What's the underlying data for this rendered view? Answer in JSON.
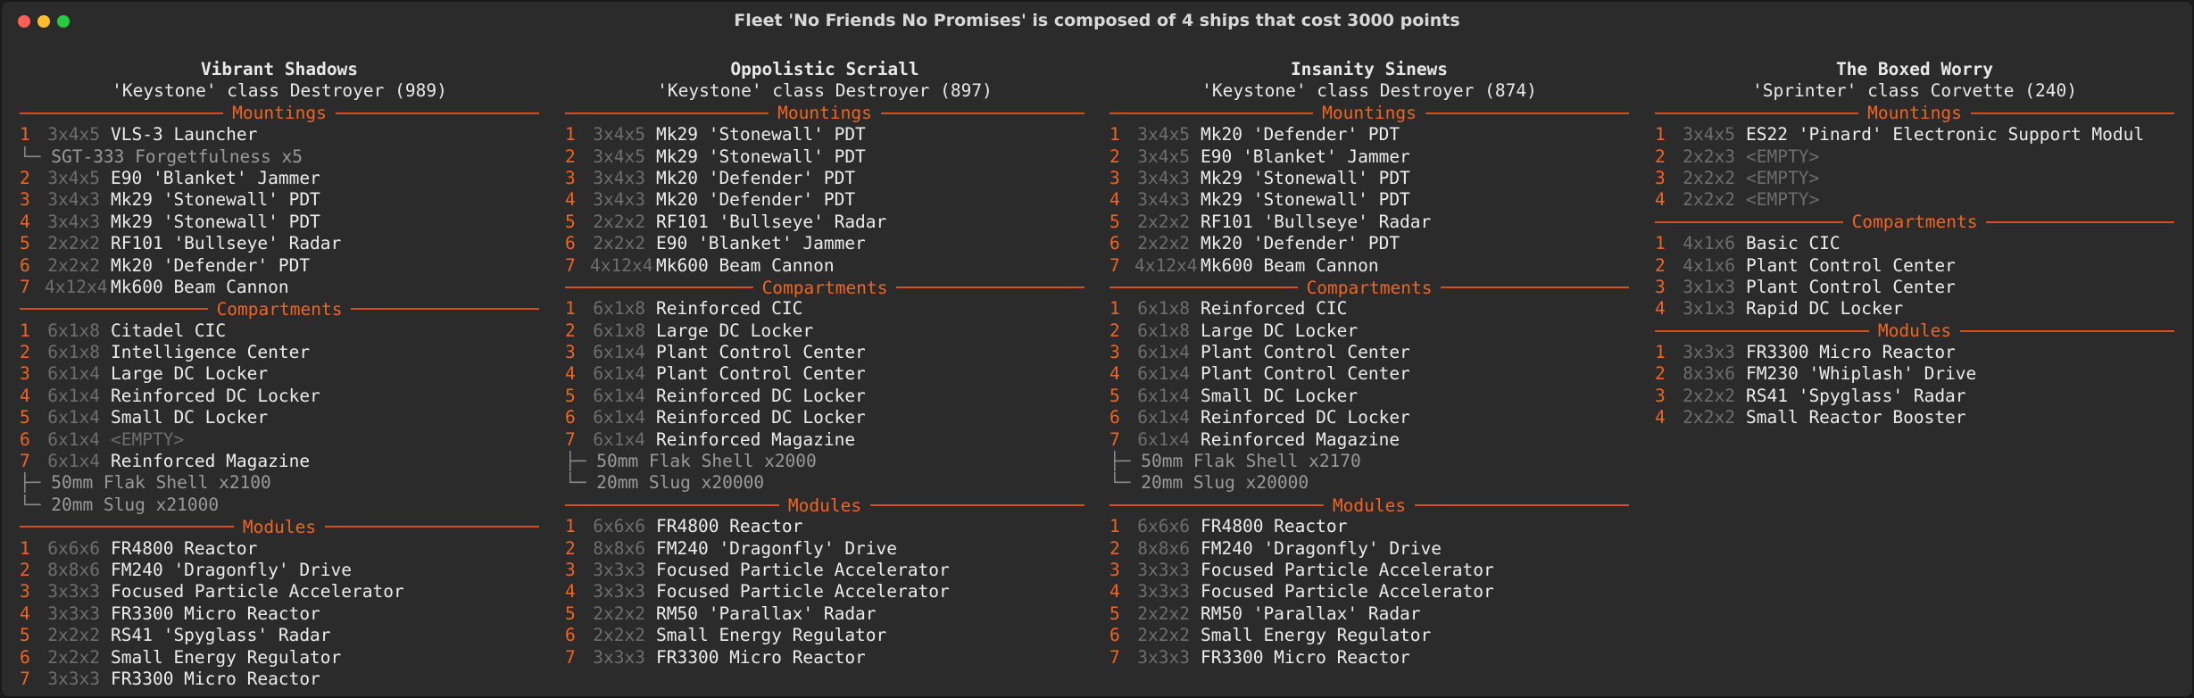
{
  "window": {
    "title": "Fleet 'No Friends No Promises' is composed of 4 ships that cost 3000 points",
    "icons": [
      "close-dot",
      "minimize-dot",
      "maximize-dot"
    ],
    "colors": {
      "accent": "#f06424",
      "rule": "#d6501f",
      "background": "#2b2b2b",
      "text": "#ececec",
      "dim": "#6e6e6e"
    }
  },
  "ships": [
    {
      "name": "Vibrant Shadows",
      "class_line": "'Keystone' class Destroyer (989)",
      "sections": [
        {
          "title": "Mountings",
          "rows": [
            {
              "num": "1",
              "size": "3x4x5",
              "name": "VLS-3 Launcher"
            },
            {
              "tree": "└─",
              "text": "SGT-333 Forgetfulness x5"
            },
            {
              "num": "2",
              "size": "3x4x5",
              "name": "E90 'Blanket' Jammer"
            },
            {
              "num": "3",
              "size": "3x4x3",
              "name": "Mk29 'Stonewall' PDT"
            },
            {
              "num": "4",
              "size": "3x4x3",
              "name": "Mk29 'Stonewall' PDT"
            },
            {
              "num": "5",
              "size": "2x2x2",
              "name": "RF101 'Bullseye' Radar"
            },
            {
              "num": "6",
              "size": "2x2x2",
              "name": "Mk20 'Defender' PDT"
            },
            {
              "num": "7",
              "size": "4x12x4",
              "name": "Mk600 Beam Cannon"
            }
          ]
        },
        {
          "title": "Compartments",
          "rows": [
            {
              "num": "1",
              "size": "6x1x8",
              "name": "Citadel CIC"
            },
            {
              "num": "2",
              "size": "6x1x8",
              "name": "Intelligence Center"
            },
            {
              "num": "3",
              "size": "6x1x4",
              "name": "Large DC Locker"
            },
            {
              "num": "4",
              "size": "6x1x4",
              "name": "Reinforced DC Locker"
            },
            {
              "num": "5",
              "size": "6x1x4",
              "name": "Small DC Locker"
            },
            {
              "num": "6",
              "size": "6x1x4",
              "name": "<EMPTY>",
              "empty": true
            },
            {
              "num": "7",
              "size": "6x1x4",
              "name": "Reinforced Magazine"
            },
            {
              "tree": "├─",
              "text": "50mm Flak Shell x2100"
            },
            {
              "tree": "└─",
              "text": "20mm Slug x21000"
            }
          ]
        },
        {
          "title": "Modules",
          "rows": [
            {
              "num": "1",
              "size": "6x6x6",
              "name": "FR4800 Reactor"
            },
            {
              "num": "2",
              "size": "8x8x6",
              "name": "FM240 'Dragonfly' Drive"
            },
            {
              "num": "3",
              "size": "3x3x3",
              "name": "Focused Particle Accelerator"
            },
            {
              "num": "4",
              "size": "3x3x3",
              "name": "FR3300 Micro Reactor"
            },
            {
              "num": "5",
              "size": "2x2x2",
              "name": "RS41 'Spyglass' Radar"
            },
            {
              "num": "6",
              "size": "2x2x2",
              "name": "Small Energy Regulator"
            },
            {
              "num": "7",
              "size": "3x3x3",
              "name": "FR3300 Micro Reactor"
            }
          ]
        }
      ]
    },
    {
      "name": "Oppolistic Scriall",
      "class_line": "'Keystone' class Destroyer (897)",
      "sections": [
        {
          "title": "Mountings",
          "rows": [
            {
              "num": "1",
              "size": "3x4x5",
              "name": "Mk29 'Stonewall' PDT"
            },
            {
              "num": "2",
              "size": "3x4x5",
              "name": "Mk29 'Stonewall' PDT"
            },
            {
              "num": "3",
              "size": "3x4x3",
              "name": "Mk20 'Defender' PDT"
            },
            {
              "num": "4",
              "size": "3x4x3",
              "name": "Mk20 'Defender' PDT"
            },
            {
              "num": "5",
              "size": "2x2x2",
              "name": "RF101 'Bullseye' Radar"
            },
            {
              "num": "6",
              "size": "2x2x2",
              "name": "E90 'Blanket' Jammer"
            },
            {
              "num": "7",
              "size": "4x12x4",
              "name": "Mk600 Beam Cannon"
            }
          ]
        },
        {
          "title": "Compartments",
          "rows": [
            {
              "num": "1",
              "size": "6x1x8",
              "name": "Reinforced CIC"
            },
            {
              "num": "2",
              "size": "6x1x8",
              "name": "Large DC Locker"
            },
            {
              "num": "3",
              "size": "6x1x4",
              "name": "Plant Control Center"
            },
            {
              "num": "4",
              "size": "6x1x4",
              "name": "Plant Control Center"
            },
            {
              "num": "5",
              "size": "6x1x4",
              "name": "Reinforced DC Locker"
            },
            {
              "num": "6",
              "size": "6x1x4",
              "name": "Reinforced DC Locker"
            },
            {
              "num": "7",
              "size": "6x1x4",
              "name": "Reinforced Magazine"
            },
            {
              "tree": "├─",
              "text": "50mm Flak Shell x2000"
            },
            {
              "tree": "└─",
              "text": "20mm Slug x20000"
            }
          ]
        },
        {
          "title": "Modules",
          "rows": [
            {
              "num": "1",
              "size": "6x6x6",
              "name": "FR4800 Reactor"
            },
            {
              "num": "2",
              "size": "8x8x6",
              "name": "FM240 'Dragonfly' Drive"
            },
            {
              "num": "3",
              "size": "3x3x3",
              "name": "Focused Particle Accelerator"
            },
            {
              "num": "4",
              "size": "3x3x3",
              "name": "Focused Particle Accelerator"
            },
            {
              "num": "5",
              "size": "2x2x2",
              "name": "RM50 'Parallax' Radar"
            },
            {
              "num": "6",
              "size": "2x2x2",
              "name": "Small Energy Regulator"
            },
            {
              "num": "7",
              "size": "3x3x3",
              "name": "FR3300 Micro Reactor"
            }
          ]
        }
      ]
    },
    {
      "name": "Insanity Sinews",
      "class_line": "'Keystone' class Destroyer (874)",
      "sections": [
        {
          "title": "Mountings",
          "rows": [
            {
              "num": "1",
              "size": "3x4x5",
              "name": "Mk20 'Defender' PDT"
            },
            {
              "num": "2",
              "size": "3x4x5",
              "name": "E90 'Blanket' Jammer"
            },
            {
              "num": "3",
              "size": "3x4x3",
              "name": "Mk29 'Stonewall' PDT"
            },
            {
              "num": "4",
              "size": "3x4x3",
              "name": "Mk29 'Stonewall' PDT"
            },
            {
              "num": "5",
              "size": "2x2x2",
              "name": "RF101 'Bullseye' Radar"
            },
            {
              "num": "6",
              "size": "2x2x2",
              "name": "Mk20 'Defender' PDT"
            },
            {
              "num": "7",
              "size": "4x12x4",
              "name": "Mk600 Beam Cannon"
            }
          ]
        },
        {
          "title": "Compartments",
          "rows": [
            {
              "num": "1",
              "size": "6x1x8",
              "name": "Reinforced CIC"
            },
            {
              "num": "2",
              "size": "6x1x8",
              "name": "Large DC Locker"
            },
            {
              "num": "3",
              "size": "6x1x4",
              "name": "Plant Control Center"
            },
            {
              "num": "4",
              "size": "6x1x4",
              "name": "Plant Control Center"
            },
            {
              "num": "5",
              "size": "6x1x4",
              "name": "Small DC Locker"
            },
            {
              "num": "6",
              "size": "6x1x4",
              "name": "Reinforced DC Locker"
            },
            {
              "num": "7",
              "size": "6x1x4",
              "name": "Reinforced Magazine"
            },
            {
              "tree": "├─",
              "text": "50mm Flak Shell x2170"
            },
            {
              "tree": "└─",
              "text": "20mm Slug x20000"
            }
          ]
        },
        {
          "title": "Modules",
          "rows": [
            {
              "num": "1",
              "size": "6x6x6",
              "name": "FR4800 Reactor"
            },
            {
              "num": "2",
              "size": "8x8x6",
              "name": "FM240 'Dragonfly' Drive"
            },
            {
              "num": "3",
              "size": "3x3x3",
              "name": "Focused Particle Accelerator"
            },
            {
              "num": "4",
              "size": "3x3x3",
              "name": "Focused Particle Accelerator"
            },
            {
              "num": "5",
              "size": "2x2x2",
              "name": "RM50 'Parallax' Radar"
            },
            {
              "num": "6",
              "size": "2x2x2",
              "name": "Small Energy Regulator"
            },
            {
              "num": "7",
              "size": "3x3x3",
              "name": "FR3300 Micro Reactor"
            }
          ]
        }
      ]
    },
    {
      "name": "The Boxed Worry",
      "class_line": "'Sprinter' class Corvette (240)",
      "sections": [
        {
          "title": "Mountings",
          "rows": [
            {
              "num": "1",
              "size": "3x4x5",
              "name": "ES22 'Pinard' Electronic Support Modul"
            },
            {
              "num": "2",
              "size": "2x2x3",
              "name": "<EMPTY>",
              "empty": true
            },
            {
              "num": "3",
              "size": "2x2x2",
              "name": "<EMPTY>",
              "empty": true
            },
            {
              "num": "4",
              "size": "2x2x2",
              "name": "<EMPTY>",
              "empty": true
            }
          ]
        },
        {
          "title": "Compartments",
          "rows": [
            {
              "num": "1",
              "size": "4x1x6",
              "name": "Basic CIC"
            },
            {
              "num": "2",
              "size": "4x1x6",
              "name": "Plant Control Center"
            },
            {
              "num": "3",
              "size": "3x1x3",
              "name": "Plant Control Center"
            },
            {
              "num": "4",
              "size": "3x1x3",
              "name": "Rapid DC Locker"
            }
          ]
        },
        {
          "title": "Modules",
          "rows": [
            {
              "num": "1",
              "size": "3x3x3",
              "name": "FR3300 Micro Reactor"
            },
            {
              "num": "2",
              "size": "8x3x6",
              "name": "FM230 'Whiplash' Drive"
            },
            {
              "num": "3",
              "size": "2x2x2",
              "name": "RS41 'Spyglass' Radar"
            },
            {
              "num": "4",
              "size": "2x2x2",
              "name": "Small Reactor Booster"
            }
          ]
        }
      ]
    }
  ]
}
